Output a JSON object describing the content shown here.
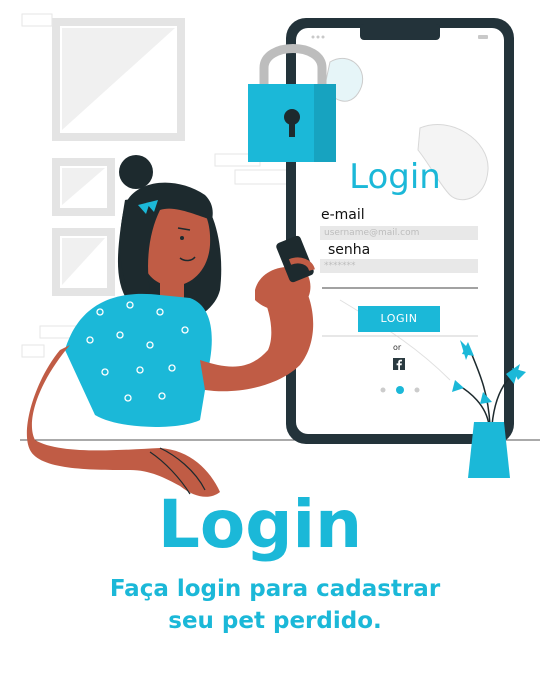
{
  "illustration": {
    "phone": {
      "title": "Login",
      "email_label": "e-mail",
      "email_placeholder": "username@mail.com",
      "password_label": "senha",
      "password_placeholder": "*******",
      "button_label": "LOGIN",
      "or_text": "or",
      "facebook_icon": "facebook-icon"
    },
    "lock_icon": "padlock-icon",
    "plant_icon": "plant-icon"
  },
  "main": {
    "title": "Login",
    "subtitle_line1": "Faça login para cadastrar",
    "subtitle_line2": "seu pet perdido."
  },
  "colors": {
    "accent": "#1bb8d8",
    "skin": "#c05c45",
    "hair": "#1d2a2e",
    "phone_frame": "#23333a",
    "shirt": "#1bb8d8"
  }
}
